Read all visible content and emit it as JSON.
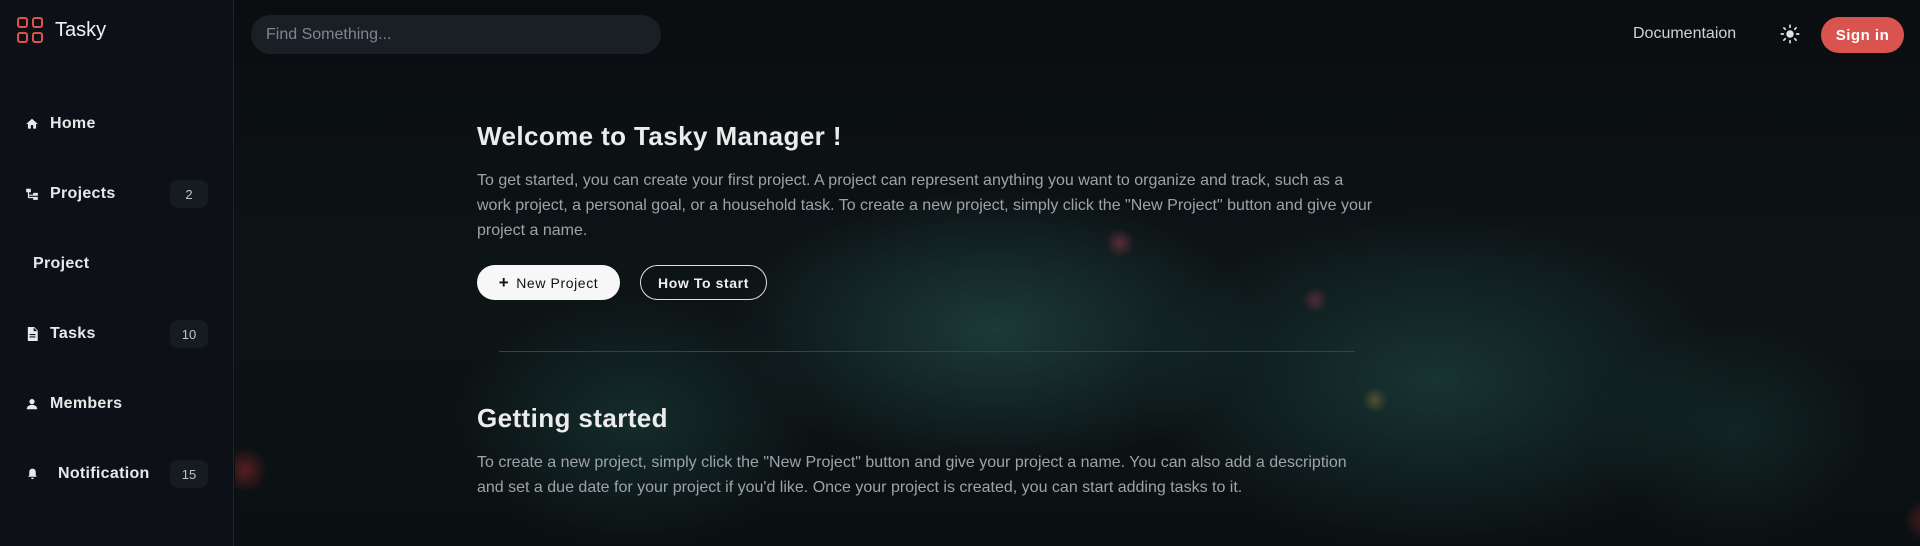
{
  "app": {
    "name": "Tasky",
    "accent_color": "#d9534f"
  },
  "header": {
    "search_placeholder": "Find Something...",
    "documentation_label": "Documentaion",
    "theme_icon": "sun-icon",
    "signin_label": "Sign in"
  },
  "sidebar": {
    "items": [
      {
        "label": "Home",
        "icon": "home-icon",
        "badge": ""
      },
      {
        "label": "Projects",
        "icon": "projects-tree-icon",
        "badge": "2"
      },
      {
        "label": "Project",
        "icon": "",
        "badge": ""
      },
      {
        "label": "Tasks",
        "icon": "task-file-icon",
        "badge": "10"
      },
      {
        "label": "Members",
        "icon": "person-icon",
        "badge": ""
      },
      {
        "label": "Notification",
        "icon": "bell-icon",
        "badge": "15"
      }
    ]
  },
  "main": {
    "welcome_title": "Welcome to Tasky Manager !",
    "welcome_text": "To get started, you can create your first project. A project can represent anything you want to organize and track, such as a work project, a personal goal, or a household task. To create a new project, simply click the \"New Project\" button and give your project a name.",
    "new_project_icon": "+",
    "new_project_label": "New Project",
    "how_to_start_label": "How To start",
    "getting_started_title": "Getting started",
    "getting_started_text": "To create a new project, simply click the \"New Project\" button and give your project a name. You can also add a description and set a due date for your project if you'd like. Once your project is created, you can start adding tasks to it."
  }
}
